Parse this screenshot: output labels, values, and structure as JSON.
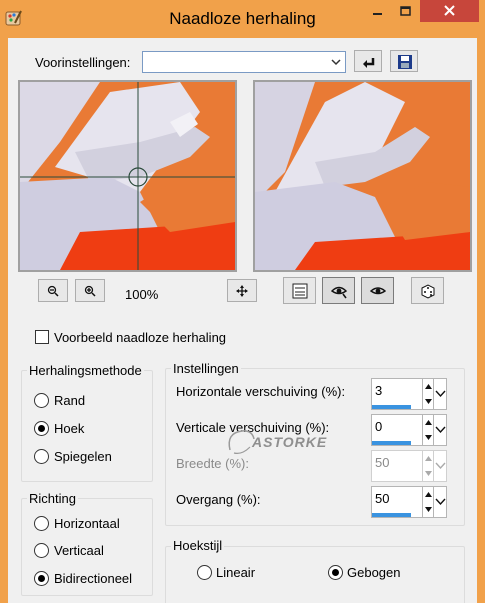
{
  "window": {
    "title": "Naadloze herhaling"
  },
  "presets": {
    "label": "Voorinstellingen:",
    "value": ""
  },
  "preview": {
    "zoom_label": "100%"
  },
  "seamless_preview": {
    "label": "Voorbeeld naadloze herhaling",
    "checked": false
  },
  "tiling_method": {
    "title": "Herhalingsmethode",
    "options": [
      "Rand",
      "Hoek",
      "Spiegelen"
    ],
    "selected": "Hoek"
  },
  "direction": {
    "title": "Richting",
    "options": [
      "Horizontaal",
      "Verticaal",
      "Bidirectioneel"
    ],
    "selected": "Bidirectioneel"
  },
  "settings": {
    "title": "Instellingen",
    "horizontal_offset": {
      "label": "Horizontale verschuiving (%):",
      "value": "3"
    },
    "vertical_offset": {
      "label": "Verticale verschuiving (%):",
      "value": "0"
    },
    "width": {
      "label": "Breedte (%):",
      "value": "50"
    },
    "transition": {
      "label": "Overgang (%):",
      "value": "50"
    }
  },
  "corner_style": {
    "title": "Hoekstijl",
    "options": [
      "Lineair",
      "Gebogen"
    ],
    "selected": "Gebogen"
  },
  "watermark": {
    "text": "ASTORKE"
  },
  "colors": {
    "title_bar": "#f1a14a",
    "close_button": "#c7463b",
    "preview_orange": "#e97a35",
    "spin_bar": "#3a93e0"
  }
}
